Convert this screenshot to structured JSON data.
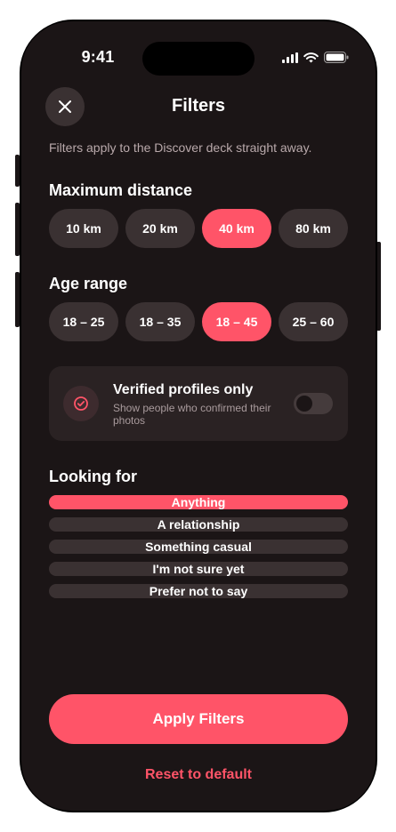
{
  "status_bar": {
    "time": "9:41"
  },
  "header": {
    "title": "Filters",
    "close_icon": "close-icon"
  },
  "subtitle": "Filters apply to the Discover deck straight away.",
  "distance": {
    "title": "Maximum distance",
    "options": [
      "10 km",
      "20 km",
      "40 km",
      "80 km"
    ],
    "selected": "40 km"
  },
  "age": {
    "title": "Age range",
    "options": [
      "18 – 25",
      "18 – 35",
      "18 – 45",
      "25 – 60"
    ],
    "selected": "18 – 45"
  },
  "verified": {
    "title": "Verified profiles only",
    "subtitle": "Show people who confirmed their photos",
    "icon": "verified-check-icon",
    "enabled": false
  },
  "looking_for": {
    "title": "Looking for",
    "options": [
      "Anything",
      "A relationship",
      "Something casual",
      "I'm not sure yet",
      "Prefer not to say"
    ],
    "selected": "Anything"
  },
  "actions": {
    "apply_label": "Apply Filters",
    "reset_label": "Reset to default"
  },
  "colors": {
    "accent": "#ff5468",
    "background": "#1b1516",
    "surface": "#3a3132",
    "card": "#2a2223"
  }
}
